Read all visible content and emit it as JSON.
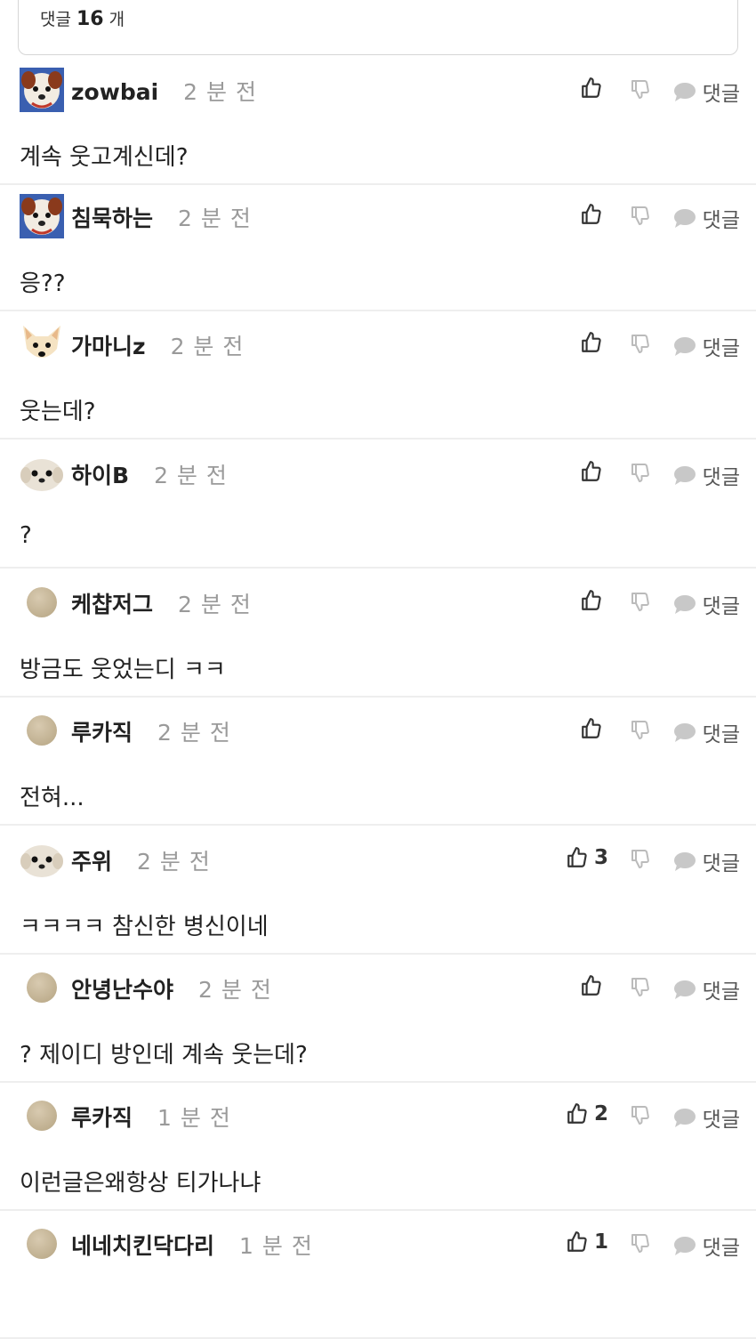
{
  "header": {
    "label": "댓글",
    "count": "16",
    "unit": "개"
  },
  "reply_label": "댓글",
  "comments": [
    {
      "nickname": "zowbai",
      "time": "2 분 전",
      "text": "계속 웃고계신데?",
      "likes": "",
      "avatar": "dog-photo-avatar"
    },
    {
      "nickname": "침묵하는",
      "time": "2 분 전",
      "text": "응??",
      "likes": "",
      "avatar": "dog-photo-avatar"
    },
    {
      "nickname": "가마니z",
      "time": "2 분 전",
      "text": "웃는데?",
      "likes": "",
      "avatar": "dog-face-avatar"
    },
    {
      "nickname": "하이B",
      "time": "2 분 전",
      "text": "?",
      "likes": "",
      "avatar": "puppy-avatar"
    },
    {
      "nickname": "케챱저그",
      "time": "2 분 전",
      "text": "방금도 웃었는디 ㅋㅋ",
      "likes": "",
      "avatar": "default-avatar"
    },
    {
      "nickname": "루카직",
      "time": "2 분 전",
      "text": "전혀...",
      "likes": "",
      "avatar": "default-avatar"
    },
    {
      "nickname": "주위",
      "time": "2 분 전",
      "text": "ㅋㅋㅋㅋ 참신한 병신이네",
      "likes": "3",
      "avatar": "puppy-avatar"
    },
    {
      "nickname": "안녕난수야",
      "time": "2 분 전",
      "text": "? 제이디 방인데 계속 웃는데?",
      "likes": "",
      "avatar": "default-avatar"
    },
    {
      "nickname": "루카직",
      "time": "1 분 전",
      "text": "이런글은왜항상 티가나냐",
      "likes": "2",
      "avatar": "default-avatar"
    },
    {
      "nickname": "네네치킨닥다리",
      "time": "1 분 전",
      "text": "",
      "likes": "1",
      "avatar": "default-avatar"
    }
  ]
}
